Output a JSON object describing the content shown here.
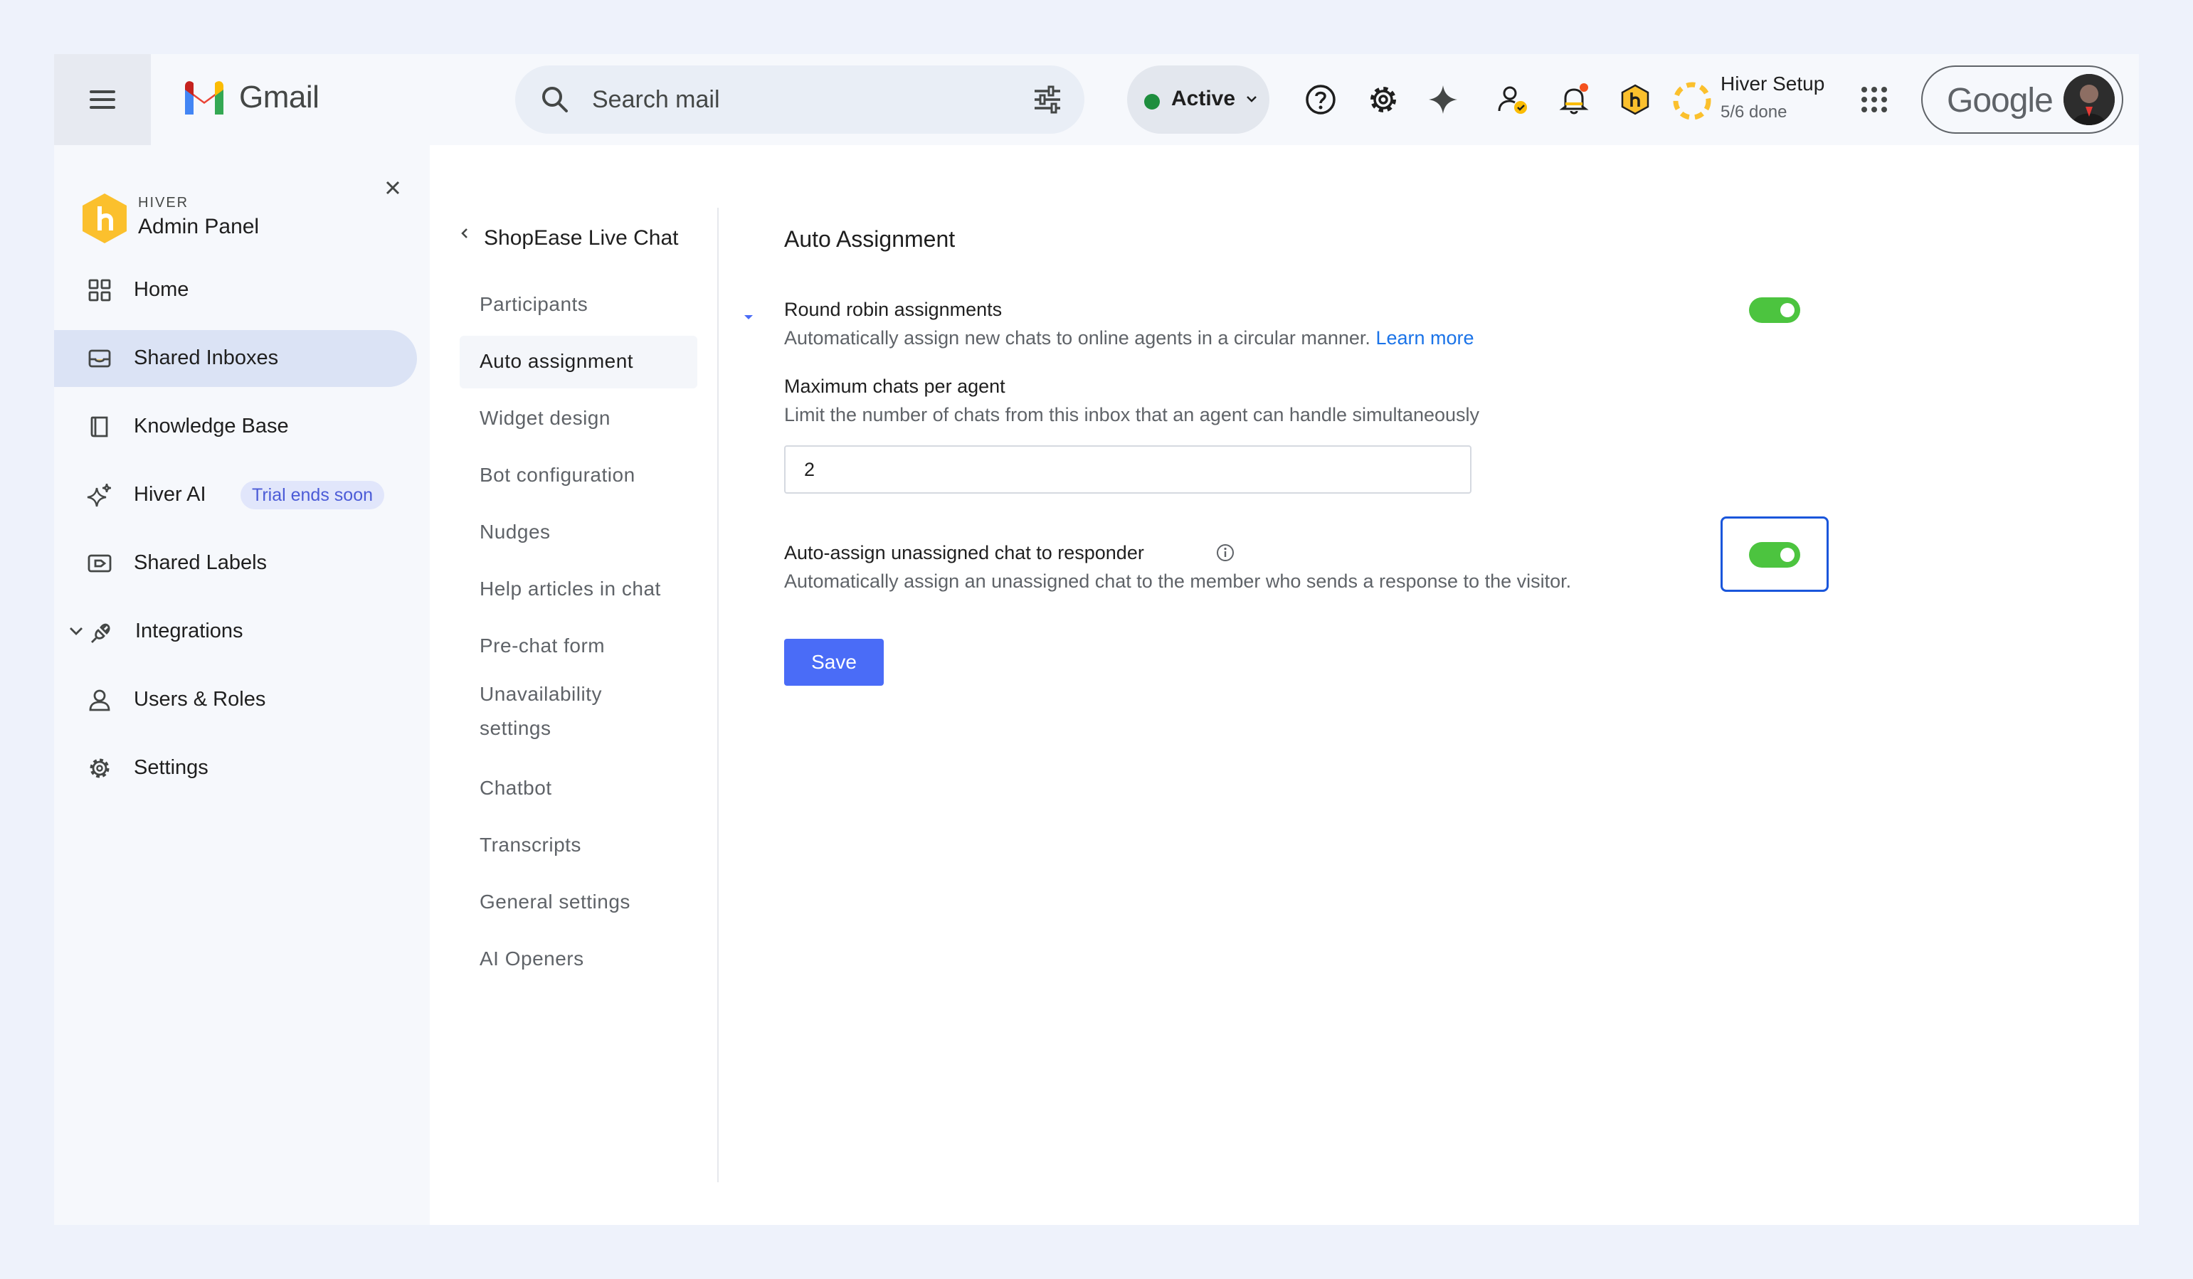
{
  "app": {
    "name": "Gmail"
  },
  "search": {
    "placeholder": "Search mail"
  },
  "status": {
    "label": "Active",
    "color": "#1e8e3e"
  },
  "topbar_icons": [
    "help-icon",
    "gear-icon",
    "sparkle-icon",
    "person-check-icon",
    "bell-icon",
    "hiver-icon"
  ],
  "setup": {
    "title": "Hiver Setup",
    "progress": "5/6 done"
  },
  "account": {
    "brand": "Google"
  },
  "sidebar": {
    "brand_small": "HIVER",
    "brand_title": "Admin Panel",
    "items": [
      {
        "label": "Home",
        "icon": "grid-icon"
      },
      {
        "label": "Shared Inboxes",
        "icon": "inbox-icon",
        "active": true
      },
      {
        "label": "Knowledge Base",
        "icon": "book-icon"
      },
      {
        "label": "Hiver AI",
        "icon": "sparkles-icon",
        "badge": "Trial ends soon"
      },
      {
        "label": "Shared Labels",
        "icon": "label-icon"
      },
      {
        "label": "Integrations",
        "icon": "plug-icon"
      },
      {
        "label": "Users & Roles",
        "icon": "user-icon"
      },
      {
        "label": "Settings",
        "icon": "gear-icon"
      }
    ]
  },
  "subnav": {
    "title": "ShopEase Live Chat",
    "items": [
      "Participants",
      "Auto assignment",
      "Widget design",
      "Bot configuration",
      "Nudges",
      "Help articles in chat",
      "Pre-chat form",
      "Unavailability settings",
      "Chatbot",
      "Transcripts",
      "General settings",
      "AI Openers"
    ],
    "active": "Auto assignment"
  },
  "panel": {
    "title": "Auto Assignment",
    "round_robin": {
      "title": "Round robin assignments",
      "desc": "Automatically assign new chats to online agents in a circular manner.",
      "link": "Learn more",
      "enabled": true
    },
    "max_chats": {
      "title": "Maximum chats per agent",
      "desc": "Limit the number of chats from this inbox that an agent can handle simultaneously",
      "value": "2"
    },
    "auto_assign": {
      "title": "Auto-assign unassigned chat to responder",
      "desc": "Automatically assign an unassigned chat to the member who sends a response to the visitor.",
      "enabled": true
    },
    "save_label": "Save"
  },
  "colors": {
    "toggle_on": "#4cc43f",
    "primary": "#4a6cf7",
    "link": "#1a73e8"
  }
}
